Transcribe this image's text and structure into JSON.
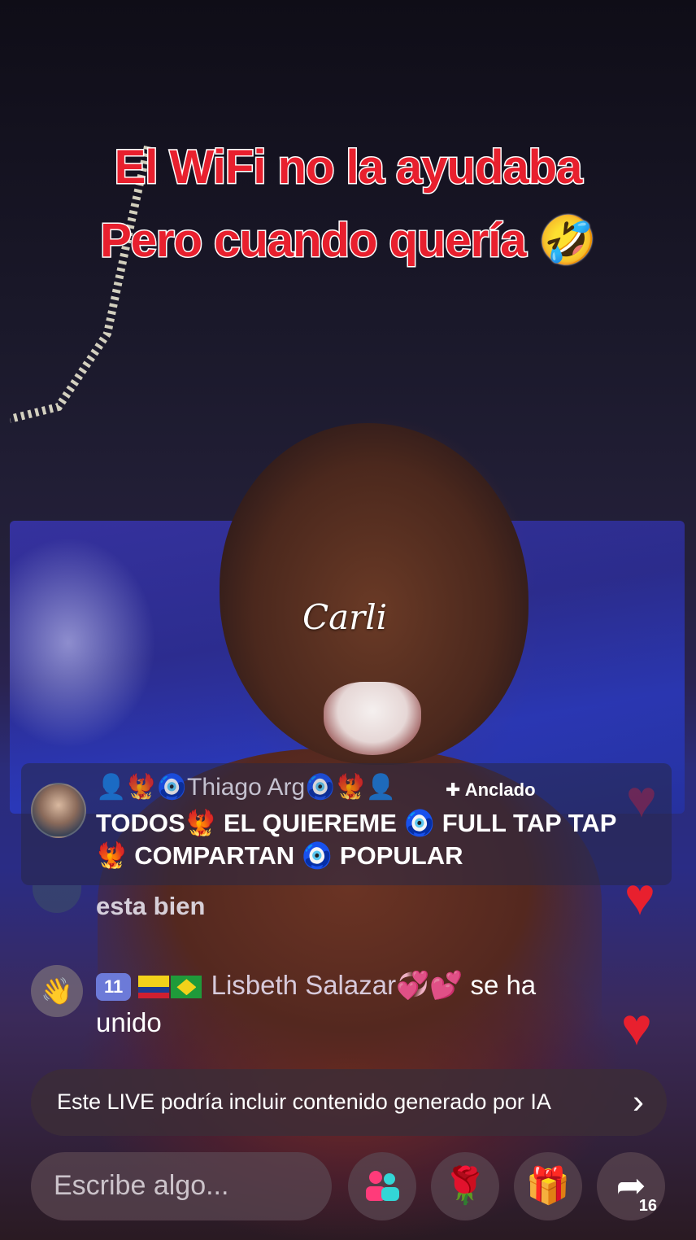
{
  "caption": {
    "line1": "El WiFi no la ayudaba",
    "line2": "Pero cuando quería",
    "emoji": "🤣"
  },
  "watermark": "Carli",
  "pinned": {
    "username": "👤🐦‍🔥🧿Thiago Arg🧿🐦‍🔥👤",
    "label": "Anclado",
    "message": "TODOS🐦‍🔥 EL QUIEREME 🧿 FULL TAP TAP 🐦‍🔥 COMPARTAN 🧿 POPULAR"
  },
  "chat": [
    {
      "text": "esta bien"
    }
  ],
  "join": {
    "level": "11",
    "name": "Lisbeth Salazar💞💕",
    "action": "se ha",
    "action2": "unido"
  },
  "ai_notice": {
    "text": "Este LIVE podría incluir contenido generado por IA"
  },
  "input": {
    "placeholder": "Escribe algo..."
  },
  "share": {
    "count": "16"
  },
  "icons": {
    "pin": "pin-icon",
    "wave": "wave-icon",
    "friends": "friends-icon",
    "rose": "rose-icon",
    "gift": "gift-icon",
    "share": "share-icon"
  }
}
